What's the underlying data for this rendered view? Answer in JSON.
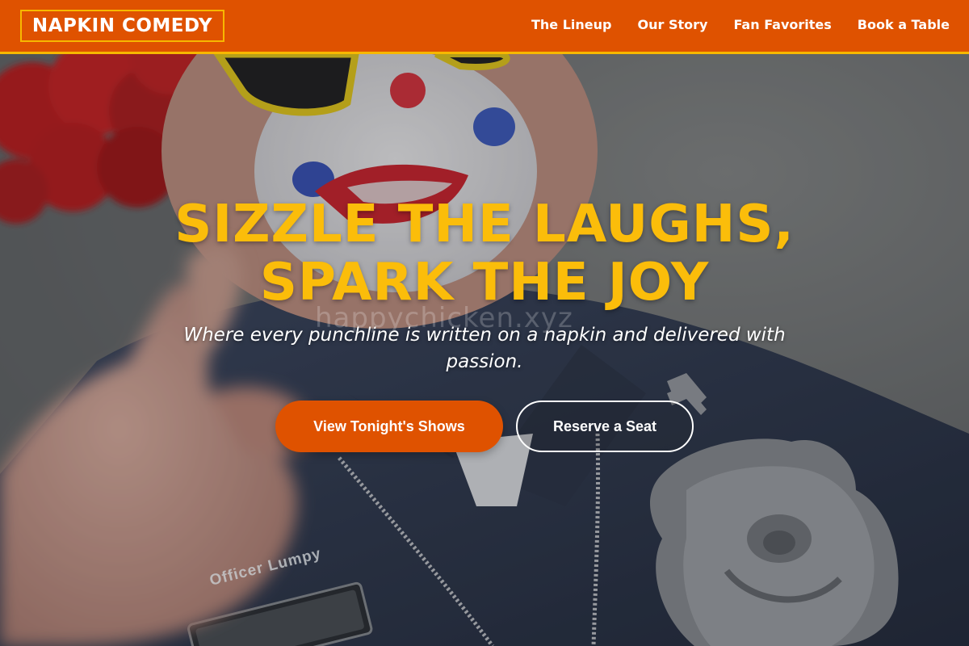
{
  "header": {
    "logo": "NAPKIN COMEDY",
    "nav": [
      "The Lineup",
      "Our Story",
      "Fan Favorites",
      "Book a Table"
    ]
  },
  "hero": {
    "headline_line1": "SIZZLE THE LAUGHS,",
    "headline_line2": "SPARK THE JOY",
    "subline": "Where every punchline is written on a napkin and delivered with passion.",
    "primary_button": "View Tonight's Shows",
    "secondary_button": "Reserve a Seat",
    "watermark": "happychicken.xyz",
    "name_tag": "Officer Lumpy"
  },
  "colors": {
    "brand_orange": "#df5200",
    "accent_gold": "#f7b800",
    "headline_yellow": "#fbbd0a"
  }
}
